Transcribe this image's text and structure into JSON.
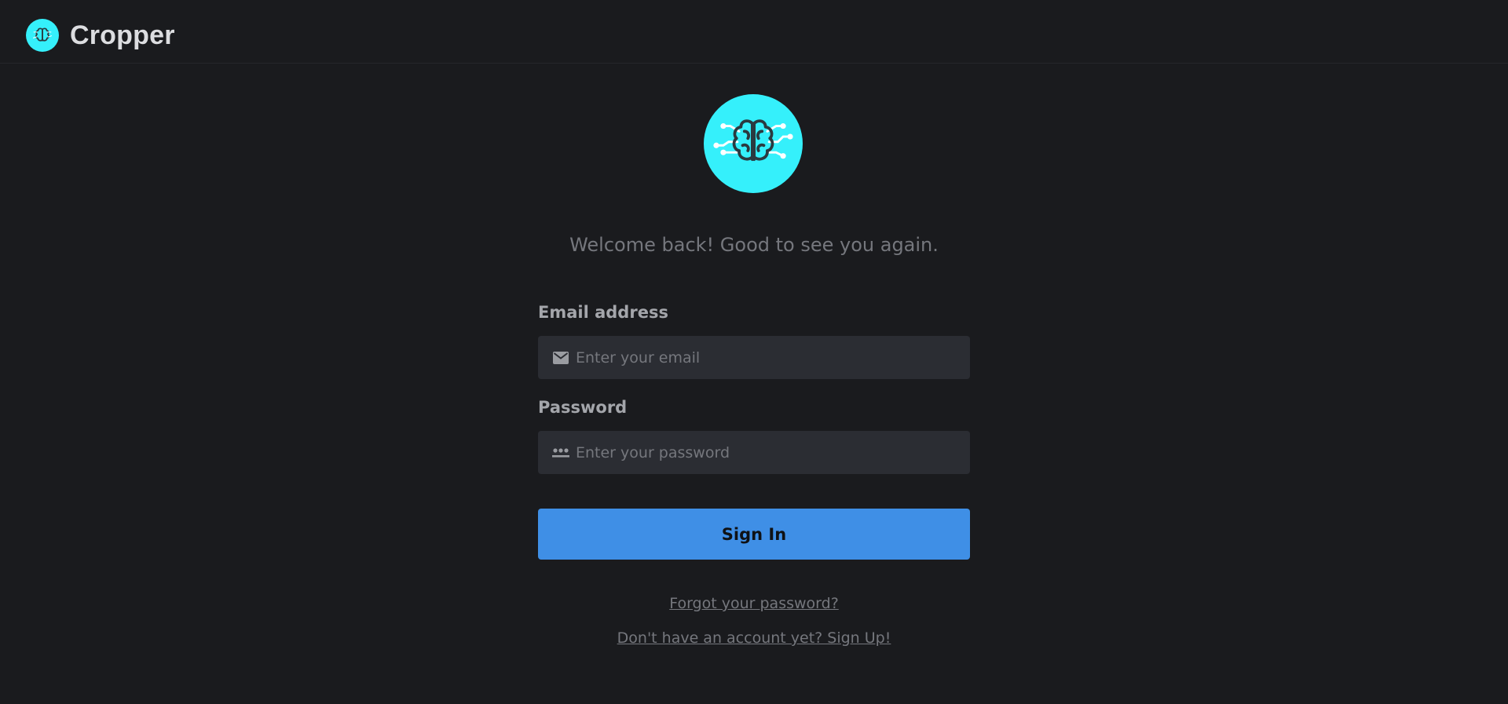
{
  "header": {
    "app_name": "Cropper",
    "logo_icon": "brain-circuit-icon",
    "logo_color": "#35f0fb"
  },
  "hero": {
    "logo_icon": "brain-circuit-icon",
    "welcome_text": "Welcome back! Good to see you again."
  },
  "form": {
    "email": {
      "label": "Email address",
      "placeholder": "Enter your email",
      "value": "",
      "icon": "mail-icon"
    },
    "password": {
      "label": "Password",
      "placeholder": "Enter your password",
      "value": "",
      "icon": "password-dots-icon"
    },
    "submit_label": "Sign In",
    "submit_color": "#3f8fe6"
  },
  "links": {
    "forgot_password": "Forgot your password?",
    "sign_up": "Don't have an account yet? Sign Up!"
  }
}
